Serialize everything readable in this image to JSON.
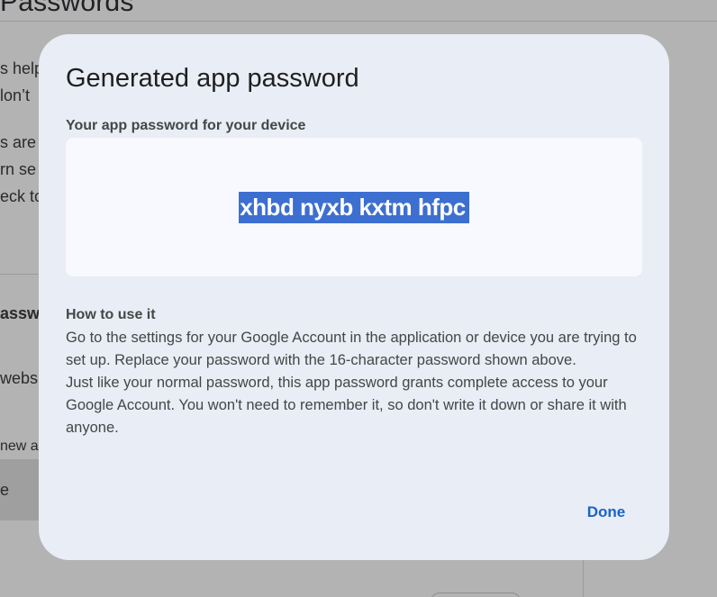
{
  "background": {
    "page_title": "Passwords",
    "fragments": [
      "s help",
      "lon’t",
      "s are",
      "rn se",
      "eck to",
      "assw",
      "webs",
      "new ap",
      "e"
    ]
  },
  "dialog": {
    "title": "Generated app password",
    "subtitle": "Your app password for your device",
    "password": "xhbd nyxb kxtm hfpc",
    "howto_heading": "How to use it",
    "howto_line1": "Go to the settings for your Google Account in the application or device you are trying to set up. Replace your password with the 16-character password shown above.",
    "howto_line2": "Just like your normal password, this app password grants complete access to your Google Account. You won't need to remember it, so don't write it down or share it with anyone.",
    "done_label": "Done"
  },
  "colors": {
    "accent": "#1a63c9",
    "selection": "#3d6fd1",
    "dialog_bg": "#e8edf6",
    "scrim": "#b3b3b3"
  }
}
